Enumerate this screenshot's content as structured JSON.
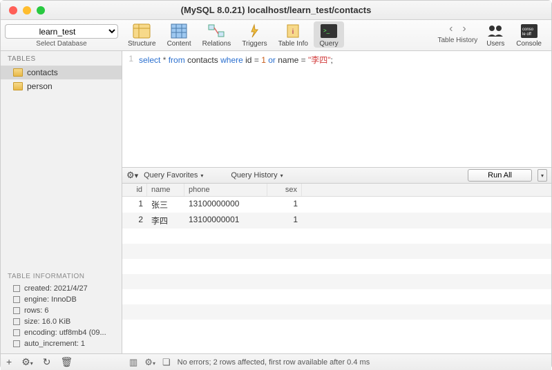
{
  "window": {
    "title": "(MySQL 8.0.21) localhost/learn_test/contacts"
  },
  "db_select": {
    "value": "learn_test",
    "label": "Select Database"
  },
  "toolbar": {
    "items": [
      {
        "id": "structure",
        "label": "Structure"
      },
      {
        "id": "content",
        "label": "Content"
      },
      {
        "id": "relations",
        "label": "Relations"
      },
      {
        "id": "triggers",
        "label": "Triggers"
      },
      {
        "id": "tableinfo",
        "label": "Table Info"
      },
      {
        "id": "query",
        "label": "Query",
        "selected": true
      }
    ],
    "nav_label": "Table History",
    "users_label": "Users",
    "console_label": "Console"
  },
  "sidebar": {
    "tables_header": "TABLES",
    "tables": [
      {
        "name": "contacts",
        "selected": true
      },
      {
        "name": "person",
        "selected": false
      }
    ],
    "info_header": "TABLE INFORMATION",
    "info": [
      {
        "label": "created: 2021/4/27"
      },
      {
        "label": "engine: InnoDB"
      },
      {
        "label": "rows: 6"
      },
      {
        "label": "size: 16.0 KiB"
      },
      {
        "label": "encoding: utf8mb4 (09..."
      },
      {
        "label": "auto_increment: 1"
      }
    ]
  },
  "editor": {
    "line_number": "1",
    "tokens": {
      "select": "select",
      "star": "*",
      "from": "from",
      "table": "contacts",
      "where": "where",
      "col1": "id",
      "eq1": "=",
      "val1": "1",
      "or": "or",
      "col2": "name",
      "eq2": "=",
      "val2": "\"李四\"",
      "semi": ";"
    }
  },
  "query_bar": {
    "favorites_label": "Query Favorites",
    "history_label": "Query History",
    "run_all_label": "Run All"
  },
  "results": {
    "columns": [
      "id",
      "name",
      "phone",
      "sex"
    ],
    "rows": [
      {
        "id": "1",
        "name": "张三",
        "phone": "13100000000",
        "sex": "1"
      },
      {
        "id": "2",
        "name": "李四",
        "phone": "13100000001",
        "sex": "1"
      }
    ]
  },
  "status": {
    "message": "No errors; 2 rows affected, first row available after 0.4 ms"
  }
}
